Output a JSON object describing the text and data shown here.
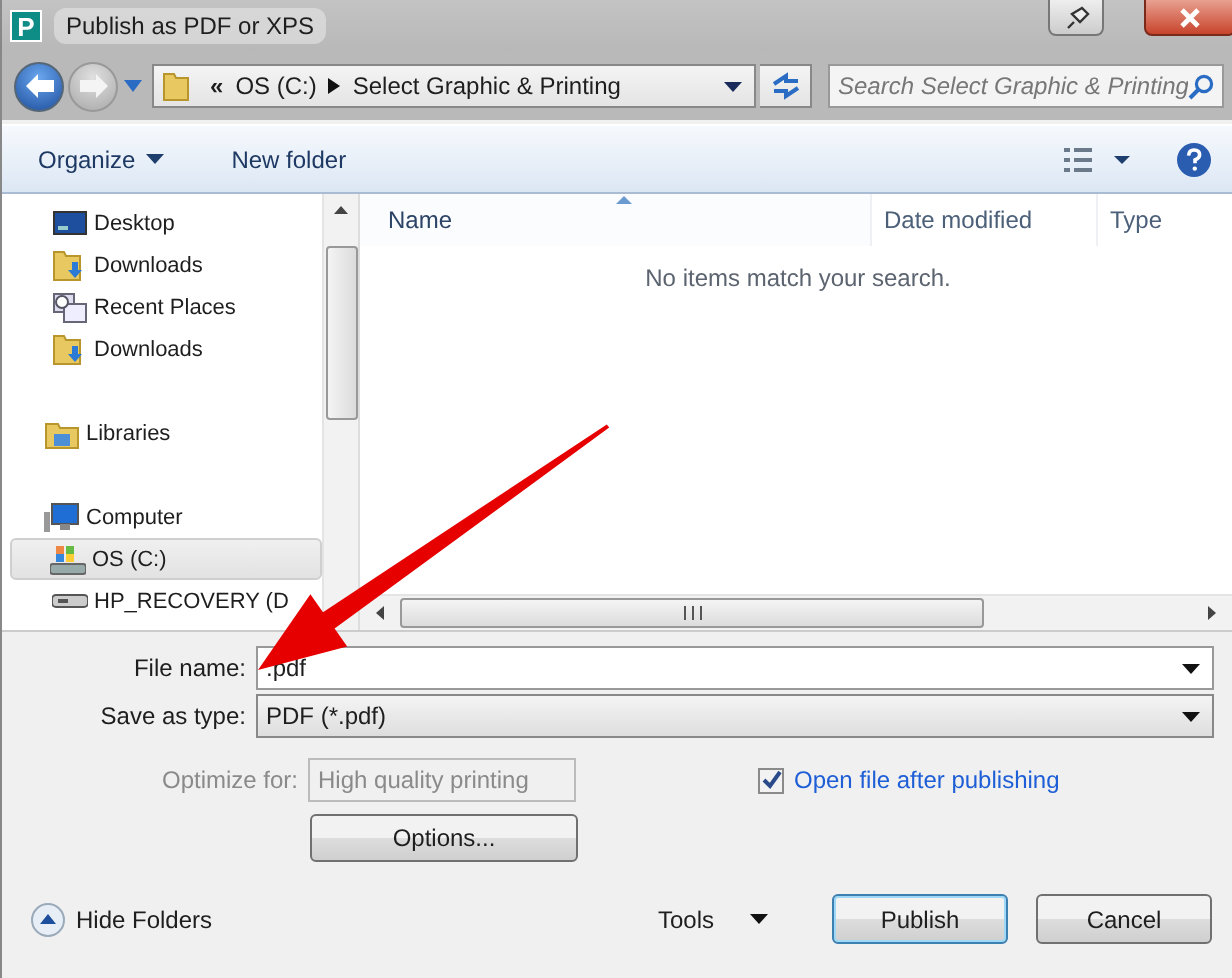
{
  "window": {
    "app_icon_letter": "P",
    "title": "Publish as PDF or XPS"
  },
  "address_bar": {
    "overflow": "«",
    "crumbs": [
      "OS (C:)",
      "Select Graphic & Printing"
    ]
  },
  "search": {
    "placeholder": "Search Select Graphic & Printing"
  },
  "toolbar": {
    "organize": "Organize",
    "new_folder": "New folder"
  },
  "nav_pane": {
    "groups": [
      {
        "children": [
          {
            "label": "Desktop",
            "kind": "desktop",
            "selected": false
          },
          {
            "label": "Downloads",
            "kind": "download-folder",
            "selected": false
          },
          {
            "label": "Recent Places",
            "kind": "recent-places",
            "selected": false
          },
          {
            "label": "Downloads",
            "kind": "download-folder",
            "selected": false
          }
        ]
      },
      {
        "label": "Libraries",
        "kind": "library",
        "selected": false
      },
      {
        "label": "Computer",
        "kind": "computer",
        "selected": false,
        "children": [
          {
            "label": "OS (C:)",
            "kind": "system-drive",
            "selected": true
          },
          {
            "label": "HP_RECOVERY (D",
            "kind": "drive",
            "selected": false
          }
        ]
      }
    ]
  },
  "file_list": {
    "columns": [
      {
        "label": "Name",
        "sorted": true
      },
      {
        "label": "Date modified",
        "sorted": false
      },
      {
        "label": "Type",
        "sorted": false
      }
    ],
    "empty_message": "No items match your search."
  },
  "form": {
    "file_name_label": "File name:",
    "file_name": ".pdf",
    "save_type_label": "Save as type:",
    "save_type": "PDF (*.pdf)",
    "optimize_label": "Optimize for:",
    "optimize_value": "High quality printing",
    "optimize_disabled": true,
    "open_after": {
      "label": "Open file after publishing",
      "checked": true
    },
    "options_button": "Options..."
  },
  "footer": {
    "hide_folders": "Hide Folders",
    "tools": "Tools",
    "buttons": [
      {
        "label": "Publish",
        "default": true
      },
      {
        "label": "Cancel",
        "default": false
      }
    ]
  }
}
